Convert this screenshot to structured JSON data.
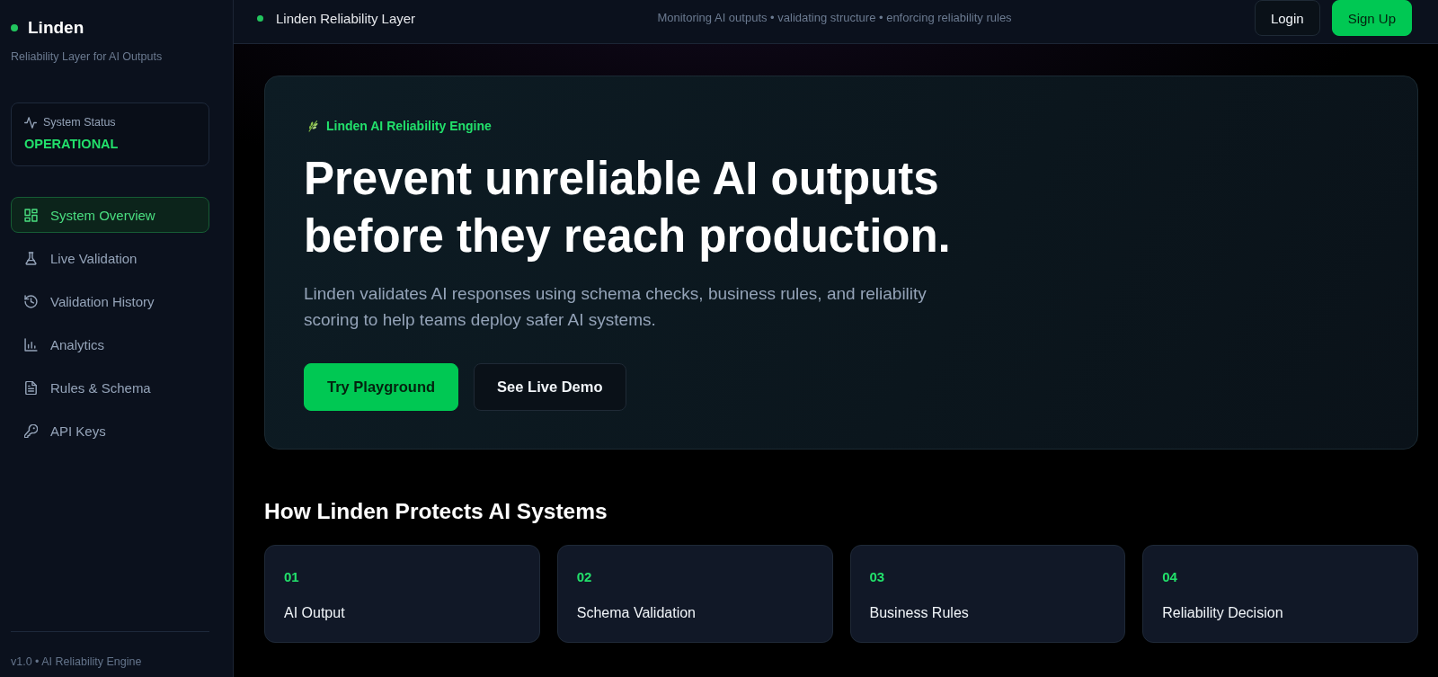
{
  "sidebar": {
    "brand": "Linden",
    "tagline": "Reliability Layer for AI Outputs",
    "system_status": {
      "label": "System Status",
      "value": "OPERATIONAL"
    },
    "nav": [
      {
        "label": "System Overview",
        "selected": true
      },
      {
        "label": "Live Validation",
        "selected": false
      },
      {
        "label": "Validation History",
        "selected": false
      },
      {
        "label": "Analytics",
        "selected": false
      },
      {
        "label": "Rules & Schema",
        "selected": false
      },
      {
        "label": "API Keys",
        "selected": false
      }
    ],
    "footer": "v1.0 • AI Reliability Engine"
  },
  "topbar": {
    "title": "Linden Reliability Layer",
    "tagline": "Monitoring AI outputs • validating structure • enforcing reliability rules",
    "buttons": [
      {
        "label": "Login",
        "kind": "outline"
      },
      {
        "label": "Sign Up",
        "kind": "primary"
      }
    ]
  },
  "hero": {
    "eyebrow": "Linden AI Reliability Engine",
    "headline": "Prevent unreliable AI outputs before they reach production.",
    "description": "Linden validates AI responses using schema checks, business rules, and reliability scoring to help teams deploy safer AI systems.",
    "buttons": [
      {
        "label": "Try Playground",
        "kind": "primary"
      },
      {
        "label": "See Live Demo",
        "kind": "outline"
      }
    ]
  },
  "how_it_works": {
    "title": "How Linden Protects AI Systems",
    "steps": [
      {
        "number": "01",
        "title": "AI Output"
      },
      {
        "number": "02",
        "title": "Schema Validation"
      },
      {
        "number": "03",
        "title": "Business Rules"
      },
      {
        "number": "04",
        "title": "Reliability Decision"
      }
    ]
  }
}
